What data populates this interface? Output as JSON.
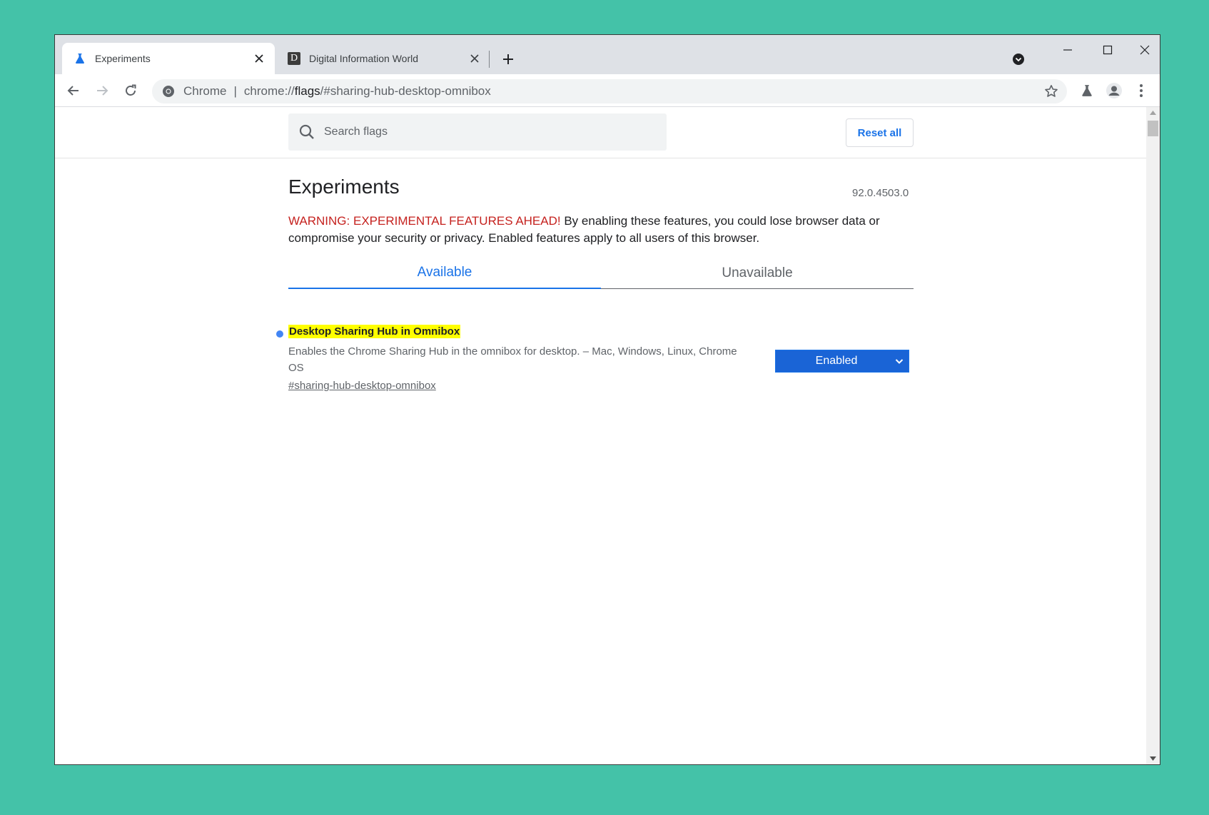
{
  "tabs": [
    {
      "title": "Experiments",
      "icon": "flask-icon",
      "active": true
    },
    {
      "title": "Digital Information World",
      "icon": "d-favicon-icon",
      "favicon_letter": "D",
      "active": false
    }
  ],
  "omnibox": {
    "scheme_label": "Chrome",
    "divider": "|",
    "url_prefix": "chrome://",
    "url_host": "flags",
    "url_rest": "/#sharing-hub-desktop-omnibox"
  },
  "search": {
    "placeholder": "Search flags"
  },
  "reset_label": "Reset all",
  "page": {
    "title": "Experiments",
    "version": "92.0.4503.0",
    "warning_red": "WARNING: EXPERIMENTAL FEATURES AHEAD!",
    "warning_rest": " By enabling these features, you could lose browser data or compromise your security or privacy. Enabled features apply to all users of this browser."
  },
  "flag_tabs": {
    "available": "Available",
    "unavailable": "Unavailable"
  },
  "flag": {
    "name": "Desktop Sharing Hub in Omnibox",
    "description": "Enables the Chrome Sharing Hub in the omnibox for desktop. – Mac, Windows, Linux, Chrome OS",
    "link": "#sharing-hub-desktop-omnibox",
    "state": "Enabled"
  },
  "colors": {
    "background": "#44c2a8",
    "accent": "#1a73e8",
    "warning": "#c5221f",
    "highlight": "#ffff00"
  }
}
